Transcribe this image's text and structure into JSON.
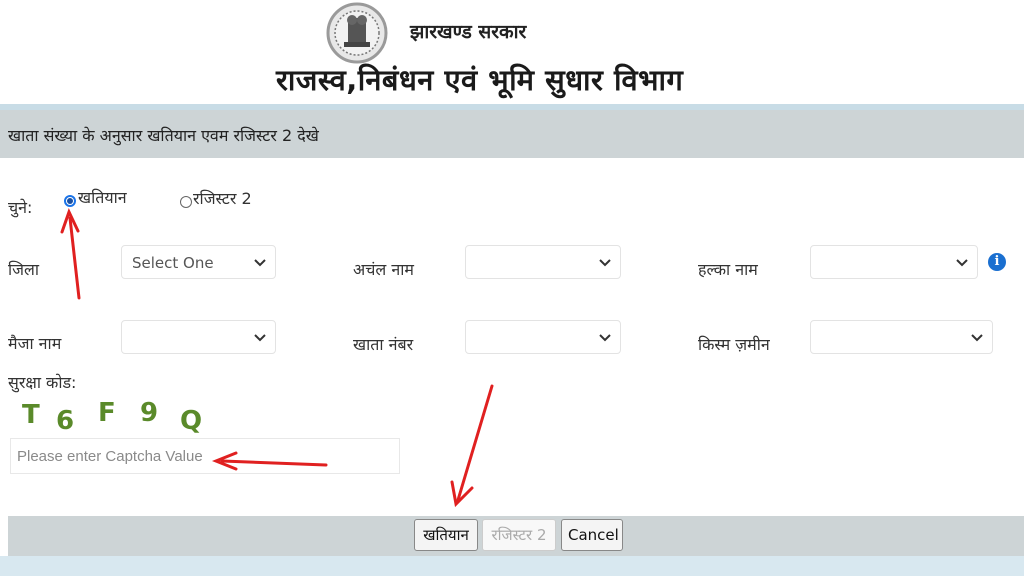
{
  "header": {
    "state_name": "झारखण्ड सरकार",
    "department": "राजस्व,निबंधन एवं भूमि सुधार विभाग"
  },
  "form": {
    "title": "खाता संख्या के अनुसार खतियान एवम रजिस्टर 2 देखे",
    "choose_label": "चुने:",
    "options": [
      {
        "label": "खतियान",
        "checked": true
      },
      {
        "label": "रजिस्टर 2",
        "checked": false
      }
    ],
    "fields": {
      "district": {
        "label": "जिला",
        "value": "Select One"
      },
      "circle": {
        "label": "अचंल नाम",
        "value": ""
      },
      "halka": {
        "label": "हल्का नाम",
        "value": ""
      },
      "mauza": {
        "label": "मैजा नाम",
        "value": ""
      },
      "khata": {
        "label": "खाता नंबर",
        "value": ""
      },
      "land_type": {
        "label": "किस्म ज़मीन",
        "value": ""
      }
    },
    "security_label": "सुरक्षा कोड:",
    "captcha_chars": [
      "T",
      "6",
      "F",
      "9",
      "Q"
    ],
    "captcha_placeholder": "Please enter Captcha Value"
  },
  "buttons": {
    "khatiyan": "खतियान",
    "register2": "रजिस्टर 2",
    "cancel": "Cancel"
  },
  "colors": {
    "title_bar": "#cdd4d6",
    "annotation_arrow": "#e02020",
    "captcha_text": "#5a8a2a",
    "radio_accent": "#1a73e8"
  },
  "icons": [
    "state-emblem",
    "chevron-down-icon",
    "info-icon",
    "arrow-annotation"
  ]
}
